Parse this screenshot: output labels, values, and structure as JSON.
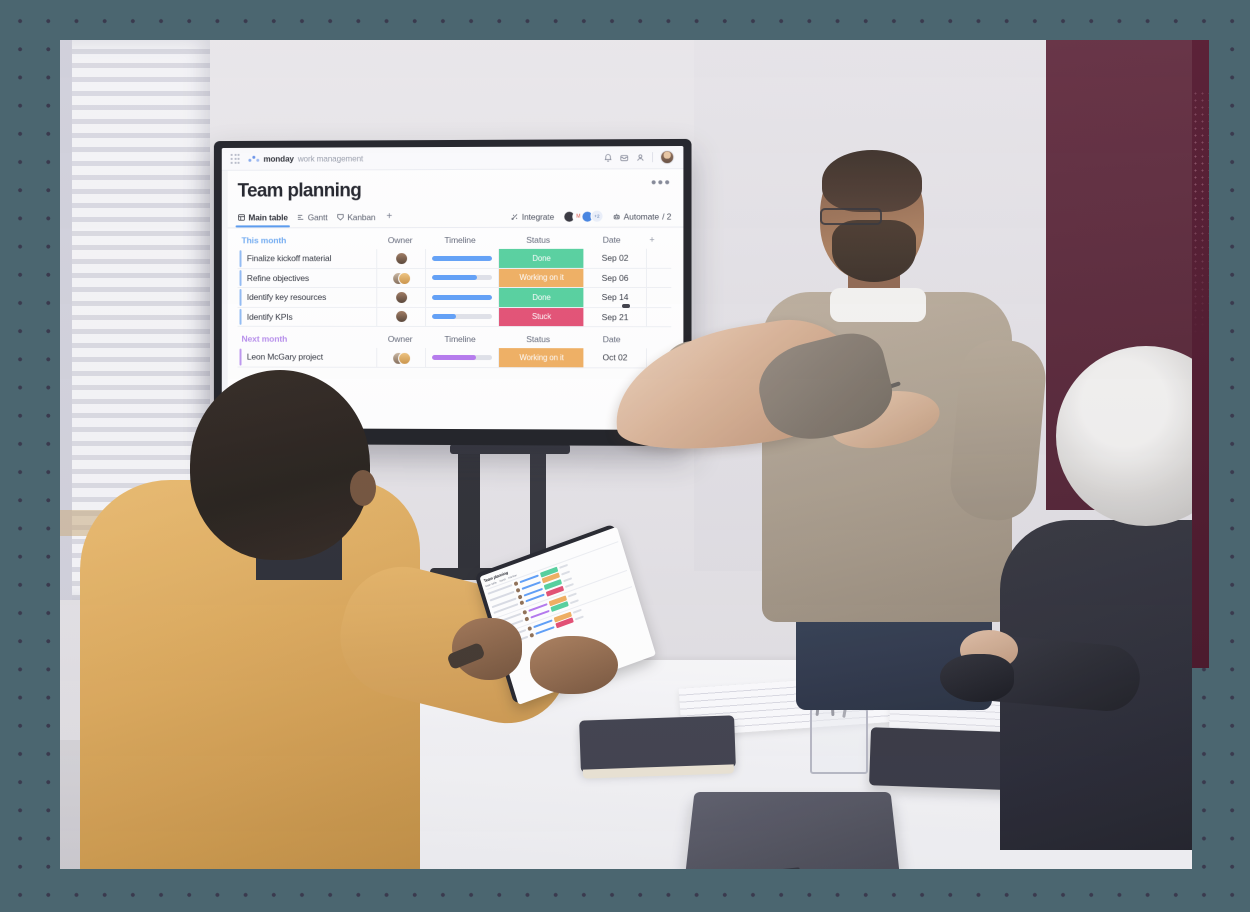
{
  "page": {
    "background_color": "#4b6670",
    "dot_color": "#3a3a4e",
    "accent_maroon": "#542034"
  },
  "app": {
    "topbar": {
      "waffle_icon": "apps-grid-icon",
      "brand_name": "monday",
      "brand_suffix": "work management",
      "icons": [
        "notifications-bell-icon",
        "inbox-icon",
        "invite-person-icon"
      ],
      "avatar": "user-avatar"
    },
    "board": {
      "title": "Team planning",
      "menu_label": "•••",
      "tabs": [
        {
          "label": "Main table",
          "icon": "table-icon",
          "active": true
        },
        {
          "label": "Gantt",
          "icon": "gantt-icon",
          "active": false
        },
        {
          "label": "Kanban",
          "icon": "kanban-icon",
          "active": false
        }
      ],
      "add_tab_label": "+",
      "integrate_label": "Integrate",
      "integrate_icon": "integrate-icon",
      "integration_avatars_overflow": "+2",
      "automate_label": "Automate",
      "automate_count": "/ 2",
      "automate_icon": "automate-robot-icon"
    },
    "columns": [
      "Owner",
      "Timeline",
      "Status",
      "Date"
    ],
    "add_column_label": "+",
    "groups": [
      {
        "name": "This month",
        "color": "#6aa8f2",
        "bar_color": "#589bf8",
        "rows": [
          {
            "name": "Finalize kickoff material",
            "owners": 1,
            "progress": 100,
            "status": "Done",
            "status_color": "#4ecf9a",
            "date": "Sep 02"
          },
          {
            "name": "Refine objectives",
            "owners": 2,
            "progress": 74,
            "status": "Working on it",
            "status_color": "#f0ac5a",
            "date": "Sep 06"
          },
          {
            "name": "Identify key resources",
            "owners": 1,
            "progress": 100,
            "status": "Done",
            "status_color": "#4ecf9a",
            "date": "Sep 14"
          },
          {
            "name": "Identify KPIs",
            "owners": 1,
            "progress": 40,
            "status": "Stuck",
            "status_color": "#e2486e",
            "date": "Sep 21"
          }
        ]
      },
      {
        "name": "Next month",
        "color": "#b387ec",
        "bar_color": "#b273ee",
        "rows": [
          {
            "name": "Leon McGary project",
            "owners": 2,
            "progress": 72,
            "status": "Working on it",
            "status_color": "#f0ac5a",
            "date": "Oct 02"
          }
        ]
      }
    ]
  },
  "tablet": {
    "title": "Team planning",
    "tabs": [
      "Main table",
      "Gantt",
      "Kanban"
    ]
  },
  "scene": {
    "description": "Three colleagues in a meeting room; a standing presenter points at a wall-mounted display showing a monday.com board, while a seated colleague holds a tablet with the same board."
  }
}
